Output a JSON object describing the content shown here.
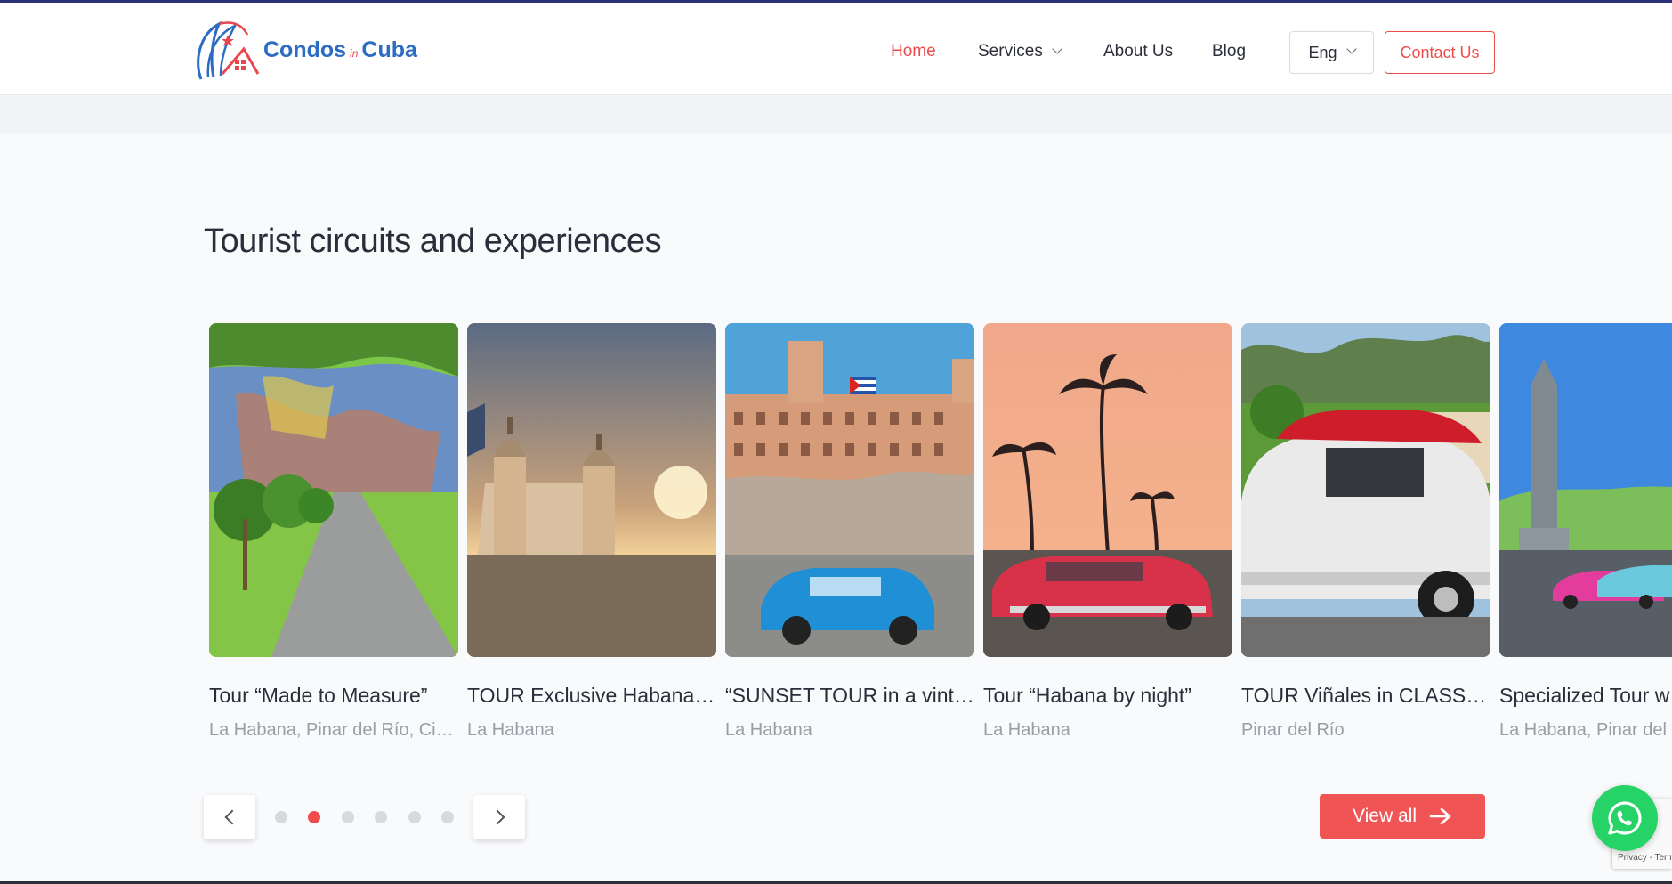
{
  "header": {
    "logo_text_1": "Condos",
    "logo_text_in": "in",
    "logo_text_2": "Cuba",
    "nav": {
      "home": "Home",
      "services": "Services",
      "about": "About Us",
      "blog": "Blog"
    },
    "language": "Eng",
    "contact": "Contact Us"
  },
  "section": {
    "title": "Tourist circuits and experiences"
  },
  "cards": [
    {
      "title": "Tour “Made to Measure”",
      "location": "La Habana, Pinar del Río, Cienfuegos"
    },
    {
      "title": "TOUR Exclusive Habana Vieja",
      "location": "La Habana"
    },
    {
      "title": "“SUNSET TOUR in a vintage car”",
      "location": "La Habana"
    },
    {
      "title": "Tour “Habana by night”",
      "location": "La Habana"
    },
    {
      "title": "TOUR Viñales in CLASSIC CAR",
      "location": "Pinar del Río"
    },
    {
      "title": "Specialized Tour w",
      "location": "La Habana, Pinar del"
    }
  ],
  "carousel": {
    "dot_count": 6,
    "active_dot": 1
  },
  "view_all": "View all",
  "recaptcha": "Privacy - Terms",
  "colors": {
    "accent": "#ef4d4d",
    "logo_blue": "#2d6cc3",
    "whatsapp": "#25d366"
  }
}
